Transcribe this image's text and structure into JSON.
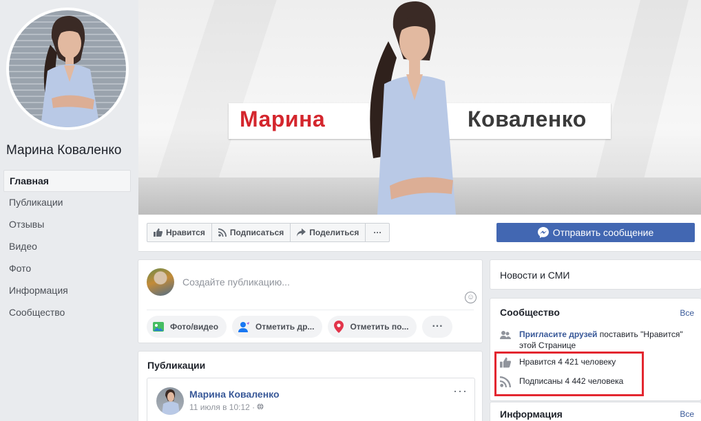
{
  "profile": {
    "name": "Марина Коваленко"
  },
  "nav": [
    "Главная",
    "Публикации",
    "Отзывы",
    "Видео",
    "Фото",
    "Информация",
    "Сообщество"
  ],
  "cover": {
    "first_name": "Марина",
    "last_name": "Коваленко"
  },
  "actions": {
    "like": "Нравится",
    "follow": "Подписаться",
    "share": "Поделиться",
    "more": "···",
    "message": "Отправить сообщение"
  },
  "composer": {
    "placeholder": "Создайте публикацию...",
    "photo": "Фото/видео",
    "tag": "Отметить др...",
    "checkin": "Отметить по...",
    "more": "···"
  },
  "publications": {
    "title": "Публикации",
    "author": "Марина Коваленко",
    "time": "11 июля в 10:12 · ",
    "more": "···"
  },
  "right": {
    "category": "Новости и СМИ",
    "community_title": "Сообщество",
    "all": "Все",
    "invite_link": "Пригласите друзей",
    "invite_text": " поставить \"Нравится\" этой Странице",
    "likes": "Нравится 4 421 человеку",
    "followers": "Подписаны 4 442 человека",
    "info_title": "Информация"
  },
  "colors": {
    "brand_blue": "#4267b2",
    "link_blue": "#385898",
    "highlight_red": "#e3262f",
    "cover_red": "#d4262d"
  }
}
